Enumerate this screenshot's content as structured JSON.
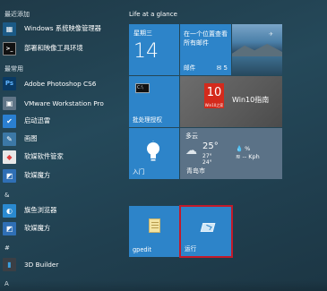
{
  "recent_header": "最近添加",
  "recent_apps": [
    {
      "label": "Windows 系统映像管理器",
      "icon": "system-image-manager-icon",
      "color": "#1b5a86"
    },
    {
      "label": "部署和映像工具环境",
      "icon": "command-prompt-icon",
      "color": "#111111"
    }
  ],
  "common_header": "最常用",
  "common_apps": [
    {
      "label": "Adobe Photoshop CS6",
      "icon": "photoshop-icon",
      "glyph": "Ps",
      "color": "#0a3a64"
    },
    {
      "label": "VMware Workstation Pro",
      "icon": "vmware-icon",
      "glyph": "▣",
      "color": "#607587"
    },
    {
      "label": "启动迅雷",
      "icon": "xunlei-icon",
      "glyph": "✔",
      "color": "#2a7fd0"
    },
    {
      "label": "画图",
      "icon": "paint-icon",
      "glyph": "✎",
      "color": "#3c78a6"
    },
    {
      "label": "软媒软件管家",
      "icon": "software-manager-icon",
      "glyph": "◆",
      "color": "#e8e8e8"
    },
    {
      "label": "软媒魔方",
      "icon": "rubik-cube-icon",
      "glyph": "◩",
      "color": "#2f6fb5"
    }
  ],
  "amp_header": "&",
  "amp_apps": [
    {
      "label": "旗鱼浏览器",
      "icon": "swordfish-browser-icon",
      "glyph": "◐",
      "color": "#2a8ad0"
    },
    {
      "label": "软媒魔方",
      "icon": "rubik-cube-icon",
      "glyph": "◩",
      "color": "#2f6fb5"
    }
  ],
  "hash_header": "#",
  "hash_apps": [
    {
      "label": "3D Builder",
      "icon": "3d-builder-icon",
      "glyph": "▮",
      "color": "#3a3f45"
    }
  ],
  "a_header": "A",
  "group_title": "Life at a glance",
  "calendar": {
    "day": "星期三",
    "date": "14"
  },
  "mail": {
    "message": "在一个位置查看所有邮件",
    "label": "邮件",
    "count": "5"
  },
  "cmd_tile": {
    "label": "批处理授权"
  },
  "news_tile": {
    "logo_number": "10",
    "logo_sub": "Win10之家",
    "title": "Win10指南"
  },
  "entry_tile": {
    "label": "入门"
  },
  "weather": {
    "condition": "多云",
    "temp": "25°",
    "high": "27°",
    "low": "24°",
    "humidity": "%",
    "wind": "-- Kph",
    "city": "青岛市"
  },
  "gpedit_tile": {
    "label": "gpedit"
  },
  "run_tile": {
    "label": "运行"
  },
  "colors": {
    "tile_blue": "#2d84c9",
    "selection_red": "#c21a2a"
  }
}
